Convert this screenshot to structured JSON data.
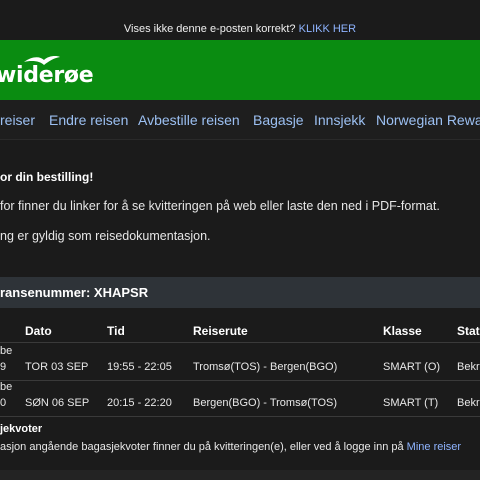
{
  "topbar": {
    "text": "Vises ikke denne e-posten korrekt?",
    "link": "KLIKK HER"
  },
  "brand": {
    "logo_text": "widerøe",
    "color": "#0a8c11"
  },
  "nav": {
    "items": [
      "reiser",
      "Endre reisen",
      "Avbestille reisen",
      "Bagasje",
      "Innsjekk",
      "Norwegian Rewa"
    ]
  },
  "content": {
    "thanks": "or din bestilling!",
    "para1": "for finner du linker for å se kvitteringen på web eller laste den ned i PDF-format.",
    "para2": "ng er gyldig som reisedokumentasjon."
  },
  "reference": {
    "label": "ransenummer: XHAPSR"
  },
  "table": {
    "headers": [
      "Dato",
      "Tid",
      "Reiserute",
      "Klasse",
      "Stat"
    ],
    "rows": [
      {
        "flight_top": "be",
        "flight_bottom": "9",
        "date": "TOR 03 SEP",
        "time": "19:55 - 22:05",
        "route": "Tromsø(TOS) - Bergen(BGO)",
        "class": "SMART (O)",
        "status": "Bekre"
      },
      {
        "flight_top": "be",
        "flight_bottom": "0",
        "date": "SØN 06 SEP",
        "time": "20:15 - 22:20",
        "route": "Bergen(BGO) - Tromsø(TOS)",
        "class": "SMART (T)",
        "status": "Bekre"
      }
    ]
  },
  "baggage": {
    "heading": "jekvoter",
    "text": "asjon angående bagasjekvoter finner du på kvitteringen(e), eller ved å logge inn på",
    "link": "Mine reiser"
  }
}
